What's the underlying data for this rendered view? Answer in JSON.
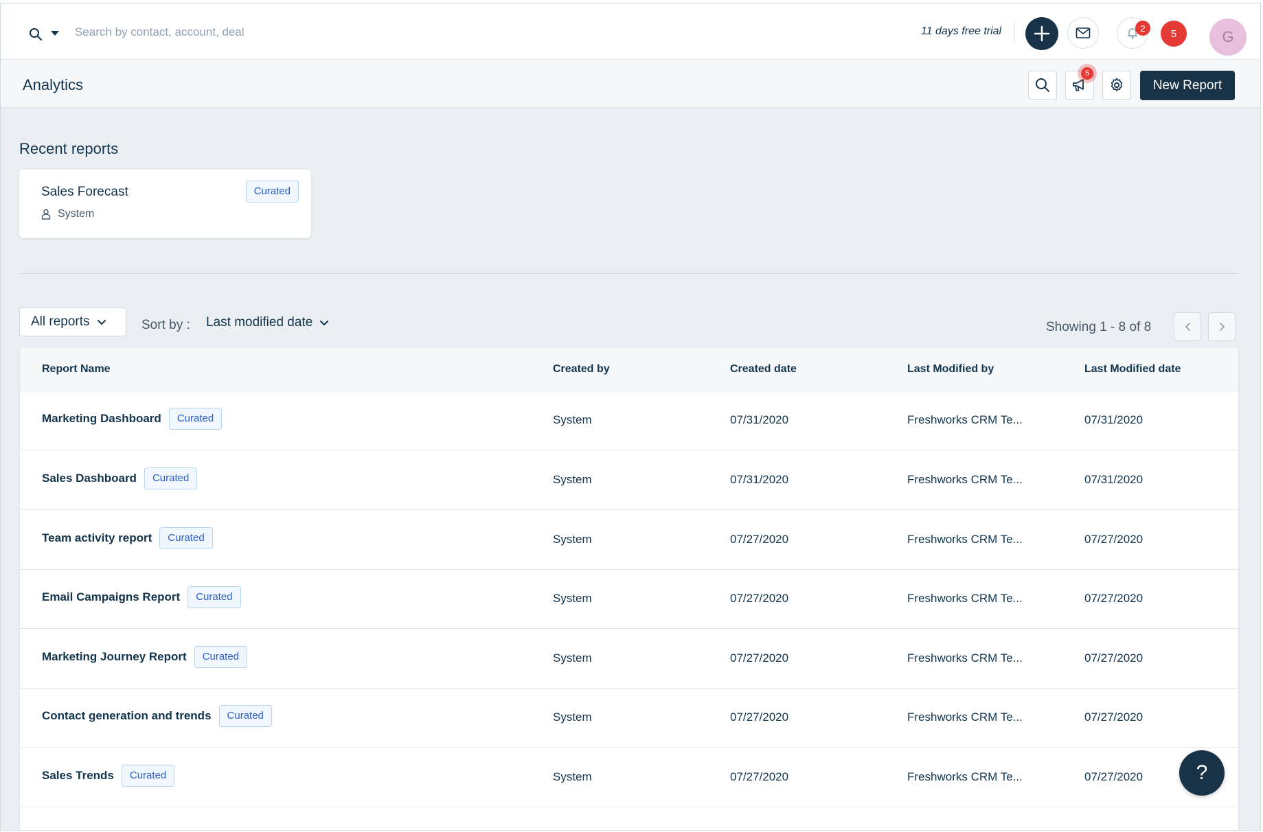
{
  "topbar": {
    "search_placeholder": "Search by contact, account, deal",
    "trial_text": "11 days free trial",
    "bell_badge": "2",
    "alert_count": "5",
    "avatar_initial": "G"
  },
  "subheader": {
    "title": "Analytics",
    "announce_badge": "5",
    "new_report_label": "New Report"
  },
  "recent": {
    "title": "Recent reports",
    "cards": [
      {
        "name": "Sales Forecast",
        "owner": "System",
        "tag": "Curated"
      }
    ]
  },
  "filters": {
    "view_label": "All reports",
    "sort_label": "Sort by :",
    "sort_value": "Last modified date",
    "showing": "Showing 1 - 8 of 8"
  },
  "table": {
    "columns": [
      "Report Name",
      "Created by",
      "Created date",
      "Last Modified by",
      "Last Modified date"
    ],
    "rows": [
      {
        "name": "Marketing Dashboard",
        "tag": "Curated",
        "created_by": "System",
        "created_date": "07/31/2020",
        "modified_by": "Freshworks CRM Te...",
        "modified_date": "07/31/2020"
      },
      {
        "name": "Sales Dashboard",
        "tag": "Curated",
        "created_by": "System",
        "created_date": "07/31/2020",
        "modified_by": "Freshworks CRM Te...",
        "modified_date": "07/31/2020"
      },
      {
        "name": "Team activity report",
        "tag": "Curated",
        "created_by": "System",
        "created_date": "07/27/2020",
        "modified_by": "Freshworks CRM Te...",
        "modified_date": "07/27/2020"
      },
      {
        "name": "Email Campaigns Report",
        "tag": "Curated",
        "created_by": "System",
        "created_date": "07/27/2020",
        "modified_by": "Freshworks CRM Te...",
        "modified_date": "07/27/2020"
      },
      {
        "name": "Marketing Journey Report",
        "tag": "Curated",
        "created_by": "System",
        "created_date": "07/27/2020",
        "modified_by": "Freshworks CRM Te...",
        "modified_date": "07/27/2020"
      },
      {
        "name": "Contact generation and trends",
        "tag": "Curated",
        "created_by": "System",
        "created_date": "07/27/2020",
        "modified_by": "Freshworks CRM Te...",
        "modified_date": "07/27/2020"
      },
      {
        "name": "Sales Trends",
        "tag": "Curated",
        "created_by": "System",
        "created_date": "07/27/2020",
        "modified_by": "Freshworks CRM Te...",
        "modified_date": "07/27/2020"
      }
    ]
  },
  "help": {
    "label": "?"
  }
}
